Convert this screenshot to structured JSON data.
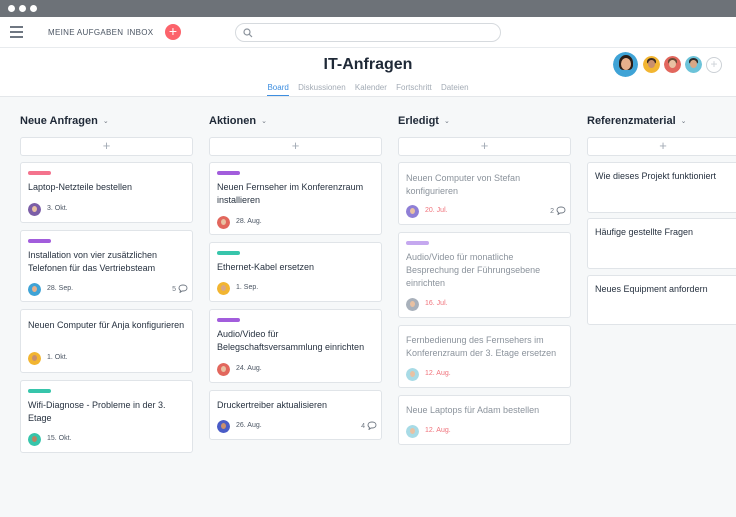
{
  "nav": {
    "my_tasks": "MEINE AUFGABEN",
    "inbox": "INBOX",
    "add_symbol": "+"
  },
  "search": {
    "value": "",
    "placeholder": ""
  },
  "project": {
    "title": "IT-Anfragen",
    "tabs": [
      "Board",
      "Diskussionen",
      "Kalender",
      "Fortschritt",
      "Dateien"
    ],
    "active_tab": "Board"
  },
  "members": {
    "add_symbol": "+"
  },
  "colors": {
    "accent": "#3d8ee0",
    "add_button": "#fc636b",
    "tag_pink": "#f4738d",
    "tag_purple": "#a25ddc",
    "tag_teal": "#37c5ab",
    "tag_lavender": "#c5a8ef",
    "done_date": "#f0727b"
  },
  "columns": [
    {
      "title": "Neue Anfragen",
      "add": "+",
      "cards": [
        {
          "title": "Laptop-Netzteile bestellen",
          "tag": "pink",
          "date": "3. Okt.",
          "comments": ""
        },
        {
          "title": "Installation von vier zusätzlichen Telefonen für das Vertriebsteam",
          "tag": "purple",
          "date": "28. Sep.",
          "comments": "5"
        },
        {
          "title": "Neuen Computer für Anja konfigurieren",
          "tag": "",
          "date": "1. Okt.",
          "comments": ""
        },
        {
          "title": "Wifi-Diagnose - Probleme in der 3. Etage",
          "tag": "teal",
          "date": "15. Okt.",
          "comments": ""
        }
      ]
    },
    {
      "title": "Aktionen",
      "add": "+",
      "cards": [
        {
          "title": "Neuen Fernseher im Konferenzraum installieren",
          "tag": "purple",
          "date": "28. Aug.",
          "comments": ""
        },
        {
          "title": "Ethernet-Kabel ersetzen",
          "tag": "teal",
          "date": "1. Sep.",
          "comments": ""
        },
        {
          "title": "Audio/Video für Belegschaftsversammlung einrichten",
          "tag": "purple",
          "date": "24. Aug.",
          "comments": ""
        },
        {
          "title": "Druckertreiber aktualisieren",
          "tag": "",
          "date": "26. Aug.",
          "comments": "4"
        }
      ]
    },
    {
      "title": "Erledigt",
      "add": "+",
      "cards": [
        {
          "title": "Neuen Computer von Stefan konfigurieren",
          "tag": "",
          "date": "20. Jul.",
          "comments": "2"
        },
        {
          "title": "Audio/Video für monatliche Besprechung der Führungsebene einrichten",
          "tag": "lavender",
          "date": "16. Jul.",
          "comments": ""
        },
        {
          "title": "Fernbedienung des Fernsehers im Konferenzraum der 3. Etage ersetzen",
          "tag": "",
          "date": "12. Aug.",
          "comments": ""
        },
        {
          "title": "Neue Laptops für Adam bestellen",
          "tag": "",
          "date": "12. Aug.",
          "comments": ""
        }
      ]
    },
    {
      "title": "Referenzmaterial",
      "add": "+",
      "cards": [
        {
          "title": "Wie dieses Projekt funktioniert"
        },
        {
          "title": "Häufige gestellte Fragen"
        },
        {
          "title": "Neues Equipment anfordern"
        }
      ]
    }
  ]
}
